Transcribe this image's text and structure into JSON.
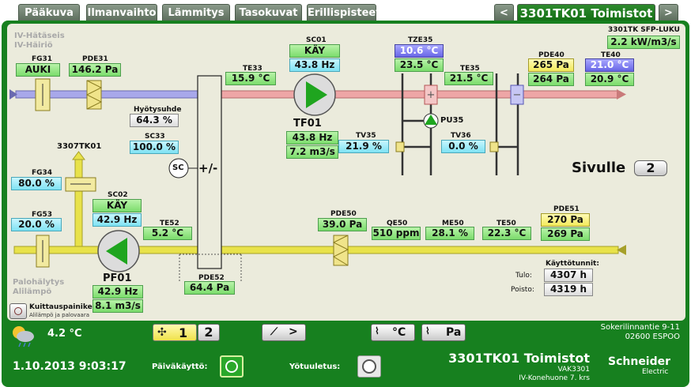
{
  "nav": {
    "tabs": [
      "Pääkuva",
      "Ilmanvaihto",
      "Lämmitys",
      "Tasokuvat",
      "Erillispisteet"
    ],
    "prev": "<",
    "next": ">",
    "title": "3301TK01 Toimistot"
  },
  "alarms": {
    "hatasei": "IV-Hätäseis",
    "hairio": "IV-Häiriö",
    "palo": "Palohälytys",
    "alilampo": "Alilämpö"
  },
  "sfp": {
    "label": "3301TK SFP-LUKU",
    "value": "2.2 kW/m3/s"
  },
  "fg31": {
    "label": "FG31",
    "value": "AUKI"
  },
  "pde31": {
    "label": "PDE31",
    "value": "146.2 Pa"
  },
  "te33": {
    "label": "TE33",
    "value": "15.9 °C"
  },
  "sc01": {
    "label": "SC01",
    "state": "KÄY",
    "freq": "43.8 Hz"
  },
  "tze35": {
    "label": "TZE35",
    "value1": "10.6 °C",
    "value2": "23.5 °C"
  },
  "te35": {
    "label": "TE35",
    "value": "21.5 °C"
  },
  "pde40": {
    "label": "PDE40",
    "value1": "265 Pa",
    "value2": "264 Pa"
  },
  "te40": {
    "label": "TE40",
    "value1": "21.0 °C",
    "value2": "20.9 °C"
  },
  "hyotysuhde": {
    "label": "Hyötysuhde",
    "value": "64.3 %"
  },
  "sc33": {
    "label": "SC33",
    "value": "100.0 %"
  },
  "sc": "SC",
  "hx": "+/-",
  "tf01": {
    "label": "TF01",
    "freq": "43.8 Hz",
    "flow": "7.2 m3/s"
  },
  "pu35": "PU35",
  "tv35": {
    "label": "TV35",
    "value": "21.9 %"
  },
  "tv36": {
    "label": "TV36",
    "value": "0.0 %"
  },
  "sivulle": {
    "label": "Sivulle",
    "value": "2"
  },
  "outdoor": "3307TK01",
  "fg34": {
    "label": "FG34",
    "value": "80.0 %"
  },
  "sc02": {
    "label": "SC02",
    "state": "KÄY",
    "freq": "42.9 Hz"
  },
  "te52": {
    "label": "TE52",
    "value": "5.2 °C"
  },
  "fg53": {
    "label": "FG53",
    "value": "20.0 %"
  },
  "pde50": {
    "label": "PDE50",
    "value": "39.0 Pa"
  },
  "qe50": {
    "label": "QE50",
    "value": "510 ppm"
  },
  "me50": {
    "label": "ME50",
    "value": "28.1 %"
  },
  "te50": {
    "label": "TE50",
    "value": "22.3 °C"
  },
  "pde51": {
    "label": "PDE51",
    "value1": "270 Pa",
    "value2": "269 Pa"
  },
  "pf01": {
    "label": "PF01",
    "freq": "42.9 Hz",
    "flow": "8.1 m3/s"
  },
  "pde52": {
    "label": "PDE52",
    "value": "64.4 Pa"
  },
  "hours": {
    "title": "Käyttötunnit:",
    "tulo_label": "Tulo:",
    "tulo": "4307 h",
    "poisto_label": "Poisto:",
    "poisto": "4319 h"
  },
  "ack": {
    "title": "Kuittauspainike",
    "sub": "Alilämpö ja palovaara"
  },
  "footer": {
    "temp": "4.2 °C",
    "speed1": "1",
    "speed2": "2",
    "trend_temp": "°C",
    "trend_pa": "Pa",
    "datetime": "1.10.2013 9:03:17",
    "paivakaytto": "Päiväkäyttö:",
    "yotuuletus": "Yötuuletus:",
    "address1": "Sokerilinnantie 9-11",
    "address2": "02600 ESPOO",
    "title": "3301TK01 Toimistot",
    "vak": "VAK3301",
    "room": "IV-Konehuone 7. krs",
    "brand1": "Schneider",
    "brand2": "Electric"
  }
}
